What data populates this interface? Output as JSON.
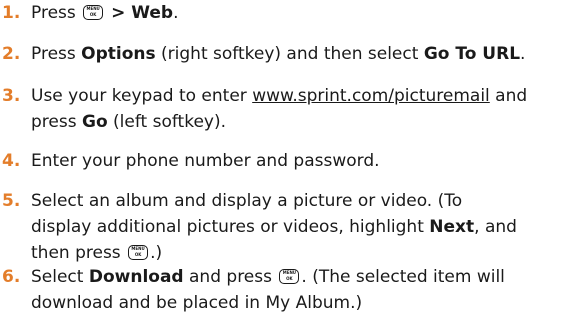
{
  "steps": [
    {
      "number": "1.",
      "lines": [
        [
          {
            "t": "Press "
          },
          {
            "icon": "menu-ok-key-icon"
          },
          {
            "t": " > Web",
            "b": true
          },
          {
            "t": "."
          }
        ]
      ]
    },
    {
      "number": "2.",
      "lines": [
        [
          {
            "t": "Press "
          },
          {
            "t": "Options",
            "b": true
          },
          {
            "t": " (right softkey) and then select "
          },
          {
            "t": "Go To URL",
            "b": true
          },
          {
            "t": "."
          }
        ]
      ]
    },
    {
      "number": "3.",
      "lines": [
        [
          {
            "t": "Use your keypad to enter "
          },
          {
            "t": "www.sprint.com/picturemail",
            "u": true
          },
          {
            "t": " and"
          }
        ],
        [
          {
            "t": "press "
          },
          {
            "t": "Go",
            "b": true
          },
          {
            "t": " (left softkey)."
          }
        ]
      ]
    },
    {
      "number": "4.",
      "lines": [
        [
          {
            "t": "Enter your phone number and password."
          }
        ]
      ]
    },
    {
      "number": "5.",
      "lines": [
        [
          {
            "t": "Select an album and display a picture or video. (To"
          }
        ],
        [
          {
            "t": "display additional pictures or videos, highlight "
          },
          {
            "t": "Next",
            "b": true
          },
          {
            "t": ", and"
          }
        ],
        [
          {
            "t": "then press "
          },
          {
            "icon": "menu-ok-key-icon"
          },
          {
            "t": ".)"
          }
        ]
      ]
    },
    {
      "number": "6.",
      "lines": [
        [
          {
            "t": "Select "
          },
          {
            "t": "Download",
            "b": true
          },
          {
            "t": " and press "
          },
          {
            "icon": "menu-ok-key-icon"
          },
          {
            "t": ". (The selected item will"
          }
        ],
        [
          {
            "t": "download and be placed in My Album.)"
          }
        ]
      ]
    }
  ],
  "key_icon": {
    "top": "MENU",
    "bottom": "OK"
  },
  "colors": {
    "step_number": "#e37d2a",
    "text": "#1a1a1a"
  }
}
